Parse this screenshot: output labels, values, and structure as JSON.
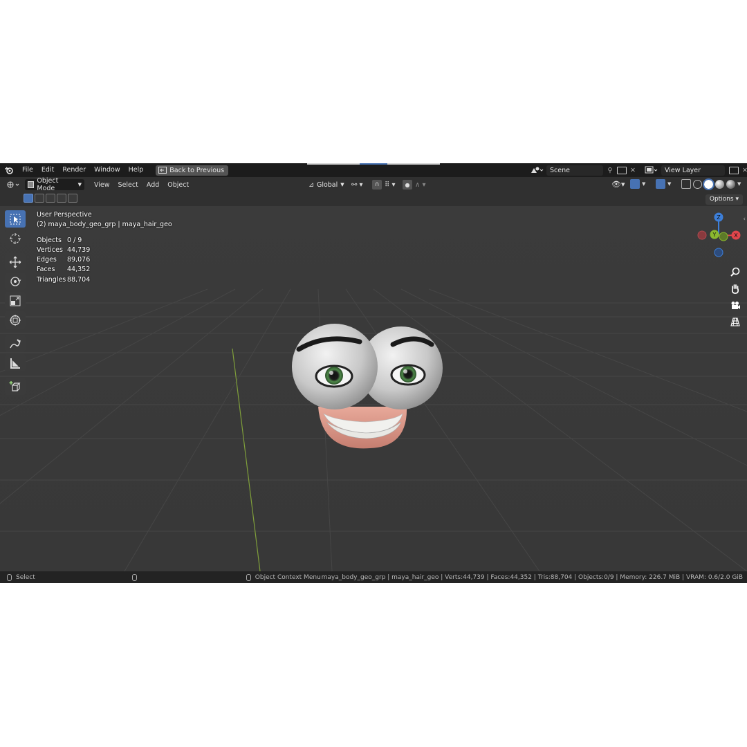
{
  "topbar": {
    "menus": [
      "File",
      "Edit",
      "Render",
      "Window",
      "Help"
    ],
    "back_button": "Back to Previous",
    "scene": "Scene",
    "view_layer": "View Layer"
  },
  "header": {
    "mode": "Object Mode",
    "menus": [
      "View",
      "Select",
      "Add",
      "Object"
    ],
    "orientation": "Global",
    "options": "Options"
  },
  "overlay": {
    "perspective": "User Perspective",
    "collection": "(2) maya_body_geo_grp | maya_hair_geo",
    "stats": [
      {
        "label": "Objects",
        "value": "0 / 9"
      },
      {
        "label": "Vertices",
        "value": "44,739"
      },
      {
        "label": "Edges",
        "value": "89,076"
      },
      {
        "label": "Faces",
        "value": "44,352"
      },
      {
        "label": "Triangles",
        "value": "88,704"
      }
    ]
  },
  "gizmo": {
    "z": "Z",
    "y": "Y",
    "x": "X"
  },
  "status": {
    "select": "Select",
    "context": "Object Context Menu",
    "info": "maya_body_geo_grp | maya_hair_geo | Verts:44,739 | Faces:44,352 | Tris:88,704 | Objects:0/9 | Memory: 226.7 MiB | VRAM: 0.6/2.0 GiB"
  },
  "colors": {
    "accent": "#4772b3",
    "x_axis": "#e0454b",
    "y_axis": "#8ab82e",
    "z_axis": "#3d7fd9"
  }
}
